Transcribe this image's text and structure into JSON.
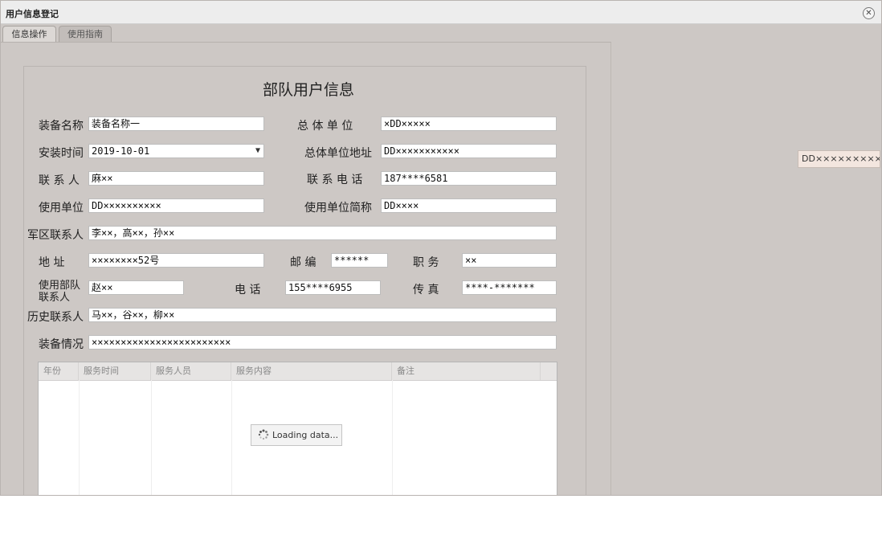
{
  "window": {
    "title": "用户信息登记"
  },
  "tabs": [
    {
      "label": "信息操作"
    },
    {
      "label": "使用指南"
    }
  ],
  "form": {
    "title": "部队用户信息",
    "equipment_name": {
      "label": "装备名称",
      "value": "装备名称一"
    },
    "overall_unit": {
      "label": "总 体 单 位",
      "value": "×DD×××××"
    },
    "install_time": {
      "label": "安装时间",
      "value": "2019-10-01"
    },
    "overall_unit_address": {
      "label": "总体单位地址",
      "value": "DD×××××××××××"
    },
    "contact": {
      "label": "联 系 人",
      "value": "麻××"
    },
    "contact_phone": {
      "label": "联 系 电 话",
      "value": "187****6581"
    },
    "using_unit": {
      "label": "使用单位",
      "value": "DD××××××××××"
    },
    "using_unit_short": {
      "label": "使用单位简称",
      "value": "DD××××"
    },
    "military_contacts": {
      "label": "军区联系人",
      "value": "李××，高××，孙××"
    },
    "address": {
      "label": "地    址",
      "value": "××××××××52号"
    },
    "postcode": {
      "label": "邮 编",
      "value": "******"
    },
    "position": {
      "label": "职 务",
      "value": "××"
    },
    "unit_contact": {
      "label": "使用部队联系人",
      "value": "赵××"
    },
    "phone": {
      "label": "电   话",
      "value": "155****6955"
    },
    "fax": {
      "label": "传    真",
      "value": "****-*******"
    },
    "history_contacts": {
      "label": "历史联系人",
      "value": "马××，谷××，柳××"
    },
    "equipment_status": {
      "label": "装备情况",
      "value": "××××××××××××××××××××××××"
    }
  },
  "grid": {
    "columns": [
      "年份",
      "服务时间",
      "服务人员",
      "服务内容",
      "备注"
    ],
    "loading_text": "Loading data..."
  },
  "tooltip": {
    "text": "DD××××××××××"
  }
}
